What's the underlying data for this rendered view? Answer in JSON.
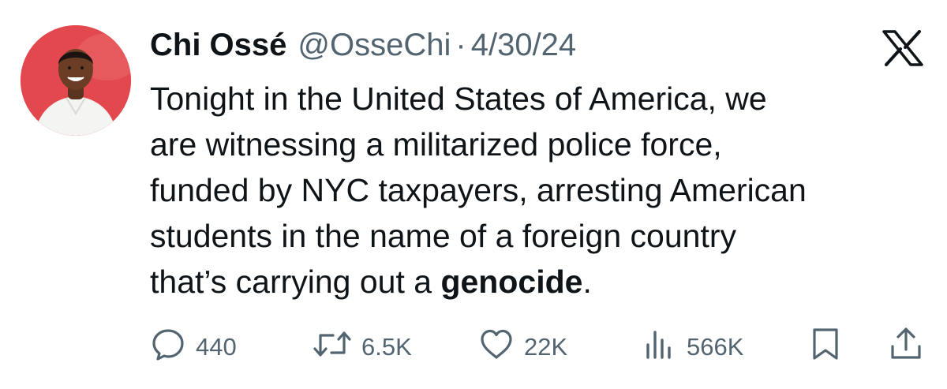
{
  "tweet": {
    "author_name": "Chi Ossé",
    "handle": "@OsseChi",
    "separator": "·",
    "date": "4/30/24",
    "text_lines": [
      "Tonight in the United States of America, we",
      "are witnessing a militarized police force,",
      "funded by NYC taxpayers, arresting American",
      "students in the name of a foreign country",
      "that’s carrying out a "
    ],
    "emphasis_word": "genocide",
    "ending_punctuation": ".",
    "stats": {
      "replies": "440",
      "reposts": "6.5K",
      "likes": "22K",
      "views": "566K"
    }
  },
  "icons": {
    "platform_logo": "x-logo-icon",
    "reply": "reply-icon",
    "repost": "repost-icon",
    "like": "heart-icon",
    "views": "views-icon",
    "bookmark": "bookmark-icon",
    "share": "share-icon"
  },
  "colors": {
    "text_primary": "#0f1419",
    "text_secondary": "#536471",
    "avatar_background": "#e2484d"
  }
}
